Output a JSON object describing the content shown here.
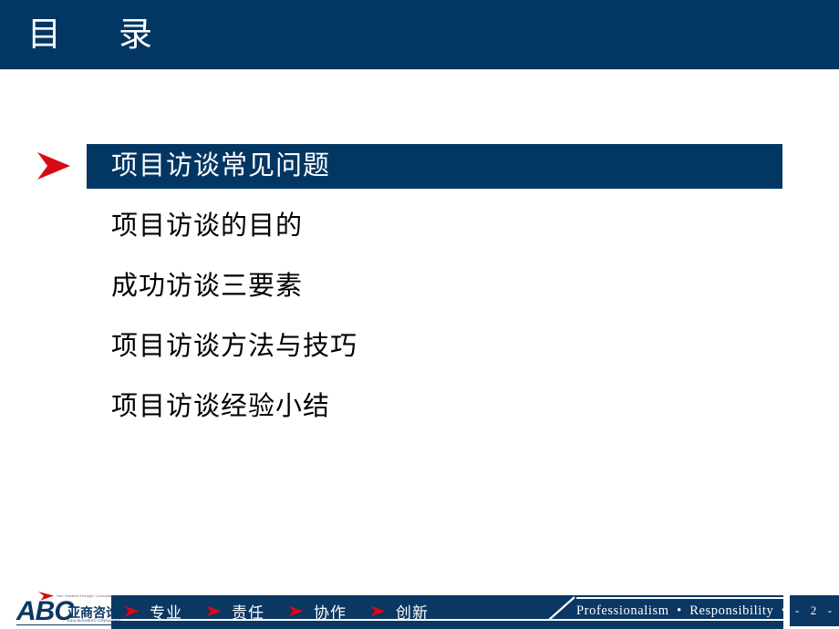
{
  "header": {
    "title": "目　录"
  },
  "toc": {
    "items": [
      {
        "label": "项目访谈常见问题",
        "active": true
      },
      {
        "label": "项目访谈的目的",
        "active": false
      },
      {
        "label": "成功访谈三要素",
        "active": false
      },
      {
        "label": "项目访谈方法与技巧",
        "active": false
      },
      {
        "label": "项目访谈经验小结",
        "active": false
      }
    ]
  },
  "footer": {
    "values_cn": [
      "专业",
      "责任",
      "协作",
      "创新"
    ],
    "values_en": "Professionalism  •  Responsibility  •  Teamwork  •  Innovation",
    "page_number": "-  2  -"
  },
  "logo": {
    "tagline": "Your Reliable Strategic Consultant",
    "wordmark": "ABC",
    "name_cn": "亚商咨询",
    "name_en": "ASIA BUSINESS CONSULTING"
  },
  "colors": {
    "navy": "#023663",
    "footer_navy": "#0b3763",
    "accent_red": "#d60a13",
    "white": "#ffffff"
  }
}
